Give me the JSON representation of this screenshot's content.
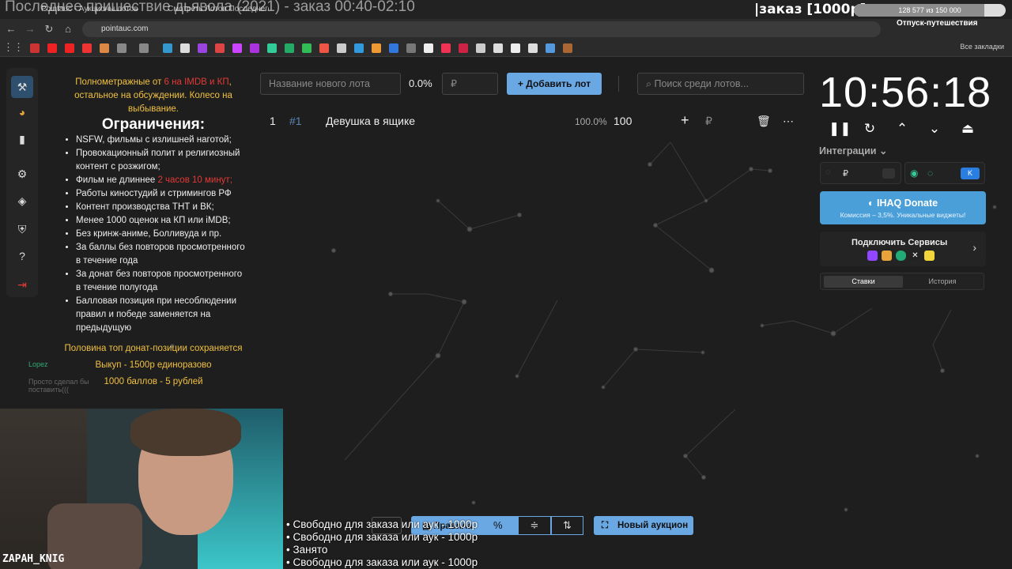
{
  "stream_overlay": {
    "title": "Последнее пришествие дьявола (2021) - заказ 00:40-02:10",
    "order_tag": "|заказ [1000р]",
    "progress_text": "128 577 из 150 000",
    "progress_fraction": 0.857,
    "goal_label": "Отпуск-путешествия",
    "cam_name": "ZAPAH_KNIG"
  },
  "browser": {
    "tabs": [
      "Pointauc - Аукционы лотов",
      "Смотреть Лотов Последнего"
    ],
    "url": "pointauc.com",
    "all_bookmarks": "Все закладки"
  },
  "sidebar": {
    "items": [
      "hammer-icon",
      "pie-chart-icon",
      "bar-chart-icon",
      "gear-icon",
      "layers-icon",
      "shield-icon",
      "help-icon",
      "logout-icon"
    ]
  },
  "rules": {
    "intro_pre": "Полнометражные от ",
    "intro_red": "6 на IMDB и КП",
    "intro_post": ", остальное на обсуждении. Колесо на выбывание.",
    "heading": "Ограничения:",
    "items": [
      "NSFW, фильмы с излишней наготой;",
      "Провокационный полит и религиозный контент с розжигом;",
      "Фильм не длиннее ",
      "Работы киностудий и стримингов РФ",
      "Контент производства ТНТ и ВК;",
      "Менее 1000 оценок на КП или iMDB;",
      "Без кринж-аниме, Болливуда и пр.",
      "За баллы без повторов просмотренного в течение года",
      "За донат без повторов просмотренного в течение полугода",
      "Балловая позиция при несоблюдении правил и победе заменяется на предыдущую"
    ],
    "duration_red": "2 часов 10 минут;",
    "footer1": "Половина топ донат-позиции сохраняется",
    "footer2": "Выкуп - 1500р единоразово",
    "footer3": "1000 баллов - 5 рублей"
  },
  "toolbar": {
    "lot_placeholder": "Название нового лота",
    "percent": "0.0%",
    "currency": "₽",
    "add_lot": "Добавить лот",
    "search_placeholder": "Поиск среди лотов..."
  },
  "lots": [
    {
      "index": "1",
      "id": "#1",
      "name": "Девушка в ящике",
      "percent": "100.0%",
      "amount": "100"
    }
  ],
  "timer": {
    "value": "10:56:18"
  },
  "integrations": {
    "label": "Интеграции",
    "donate_title": "IHAQ Donate",
    "donate_sub": "Комиссия – 3,5%. Уникальные виджеты!",
    "connect_title": "Подключить Сервисы",
    "tab_bets": "Ставки",
    "tab_history": "История"
  },
  "bottom": {
    "rules_btn": "Правила",
    "new_auction": "Новый аукцион"
  },
  "status_list": [
    "• Свободно для заказа или аук - 1000р",
    "• Свободно для заказа или аук - 1000р",
    "• Занято",
    "• Свободно для заказа или аук - 1000р"
  ],
  "chat": {
    "user": "Lopez",
    "line1": "Просто сделал бы",
    "line2": "поставить((("
  },
  "colors": {
    "accent": "#6aa8e4",
    "donate": "#4a9fd8",
    "highlight": "#f0c040",
    "warning": "#e53935"
  }
}
